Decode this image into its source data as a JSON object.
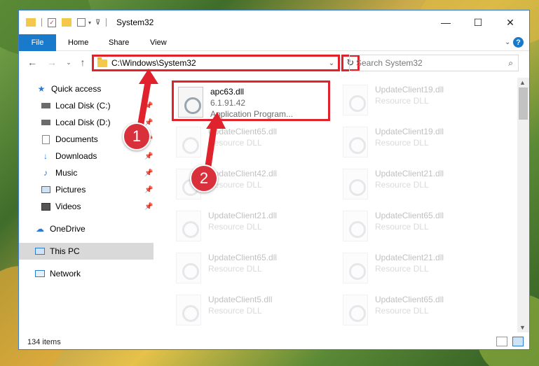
{
  "window": {
    "title": "System32",
    "controls": {
      "minimize": "—",
      "maximize": "☐",
      "close": "✕"
    }
  },
  "ribbon": {
    "file": "File",
    "home": "Home",
    "share": "Share",
    "view": "View",
    "help": "?"
  },
  "nav": {
    "address": "C:\\Windows\\System32",
    "search_placeholder": "Search System32"
  },
  "sidebar": {
    "items": [
      {
        "label": "Quick access",
        "icon": "star-icon"
      },
      {
        "label": "Local Disk (C:)",
        "icon": "drive-icon"
      },
      {
        "label": "Local Disk (D:)",
        "icon": "drive-icon"
      },
      {
        "label": "Documents",
        "icon": "documents-icon"
      },
      {
        "label": "Downloads",
        "icon": "download-icon"
      },
      {
        "label": "Music",
        "icon": "music-icon"
      },
      {
        "label": "Pictures",
        "icon": "pictures-icon"
      },
      {
        "label": "Videos",
        "icon": "videos-icon"
      },
      {
        "label": "OneDrive",
        "icon": "cloud-icon"
      },
      {
        "label": "This PC",
        "icon": "computer-icon"
      },
      {
        "label": "Network",
        "icon": "network-icon"
      }
    ]
  },
  "files": [
    {
      "name": "apc63.dll",
      "line2": "6.1.91.42",
      "line3": "Application Program..."
    },
    {
      "name": "UpdateClient19.dll",
      "line2": "Resource DLL"
    },
    {
      "name": "UpdateClient65.dll",
      "line2": "Resource DLL"
    },
    {
      "name": "UpdateClient19.dll",
      "line2": "Resource DLL"
    },
    {
      "name": "UpdateClient42.dll",
      "line2": "Resource DLL"
    },
    {
      "name": "UpdateClient21.dll",
      "line2": "Resource DLL"
    },
    {
      "name": "UpdateClient21.dll",
      "line2": "Resource DLL"
    },
    {
      "name": "UpdateClient65.dll",
      "line2": "Resource DLL"
    },
    {
      "name": "UpdateClient65.dll",
      "line2": "Resource DLL"
    },
    {
      "name": "UpdateClient21.dll",
      "line2": "Resource DLL"
    },
    {
      "name": "UpdateClient5.dll",
      "line2": "Resource DLL"
    },
    {
      "name": "UpdateClient65.dll",
      "line2": "Resource DLL"
    }
  ],
  "status": {
    "count": "134 items"
  },
  "annotations": {
    "step1": "1",
    "step2": "2"
  },
  "colors": {
    "accent": "#1979ca",
    "highlight": "#e0222d"
  }
}
